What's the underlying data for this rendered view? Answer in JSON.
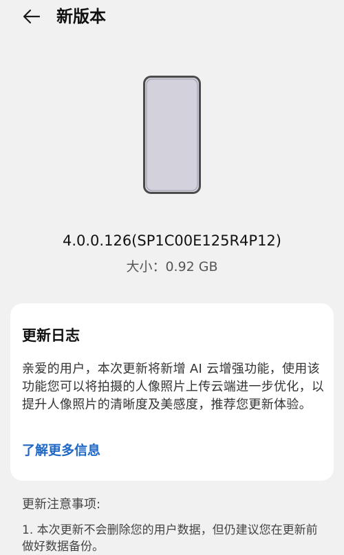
{
  "header": {
    "title": "新版本",
    "back_icon": "arrow-left-icon"
  },
  "update": {
    "version": "4.0.0.126(SP1C00E125R4P12)",
    "size_label": "大小：",
    "size_value": "0.92 GB",
    "illustration": "phone-device-icon"
  },
  "changelog": {
    "title": "更新日志",
    "body": "亲爱的用户，本次更新将新增 AI 云增强功能，使用该功能您可以将拍摄的人像照片上传云端进一步优化，以提升人像照片的清晰度及美感度，推荐您更新体验。",
    "more_link": "了解更多信息"
  },
  "notes": {
    "title": "更新注意事项:",
    "item_1": "1. 本次更新不会删除您的用户数据，但仍建议您在更新前做好数据备份。"
  },
  "colors": {
    "background": "#f1f1f1",
    "card": "#ffffff",
    "link": "#1f67c6"
  }
}
